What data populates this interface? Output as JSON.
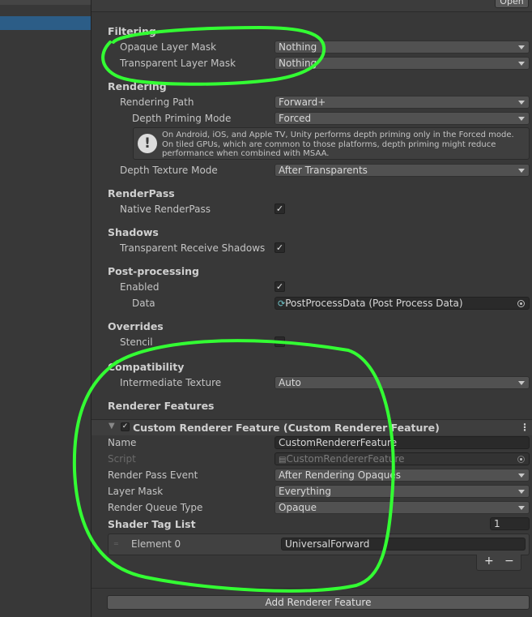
{
  "topbar": {
    "open_label": "Open"
  },
  "filtering": {
    "header": "Filtering",
    "opaque_label": "Opaque Layer Mask",
    "opaque_value": "Nothing",
    "transparent_label": "Transparent Layer Mask",
    "transparent_value": "Nothing"
  },
  "rendering": {
    "header": "Rendering",
    "path_label": "Rendering Path",
    "path_value": "Forward+",
    "depth_priming_label": "Depth Priming Mode",
    "depth_priming_value": "Forced",
    "help_text": "On Android, iOS, and Apple TV, Unity performs depth priming only in the Forced mode. On tiled GPUs, which are common to those platforms, depth priming might reduce performance when combined with MSAA.",
    "depth_texture_label": "Depth Texture Mode",
    "depth_texture_value": "After Transparents"
  },
  "renderpass": {
    "header": "RenderPass",
    "native_label": "Native RenderPass",
    "native_checked": true
  },
  "shadows": {
    "header": "Shadows",
    "transparent_label": "Transparent Receive Shadows",
    "transparent_checked": true
  },
  "postprocessing": {
    "header": "Post-processing",
    "enabled_label": "Enabled",
    "enabled_checked": true,
    "data_label": "Data",
    "data_value": "PostProcessData (Post Process Data)"
  },
  "overrides": {
    "header": "Overrides",
    "stencil_label": "Stencil"
  },
  "compatibility": {
    "header": "Compatibility",
    "intermediate_label": "Intermediate Texture",
    "intermediate_value": "Auto"
  },
  "renderer_features": {
    "header": "Renderer Features",
    "feature_title": "Custom Renderer Feature (Custom Renderer Feature)",
    "name_label": "Name",
    "name_value": "CustomRendererFeature",
    "script_label": "Script",
    "script_value": "CustomRendererFeature",
    "event_label": "Render Pass Event",
    "event_value": "After Rendering Opaques",
    "layer_label": "Layer Mask",
    "layer_value": "Everything",
    "queue_label": "Render Queue Type",
    "queue_value": "Opaque",
    "shader_tag_label": "Shader Tag List",
    "shader_tag_count": "1",
    "element_label": "Element 0",
    "element_value": "UniversalForward",
    "plus": "+",
    "minus": "−",
    "add_button": "Add Renderer Feature"
  },
  "annotation_color": "#33ff33"
}
